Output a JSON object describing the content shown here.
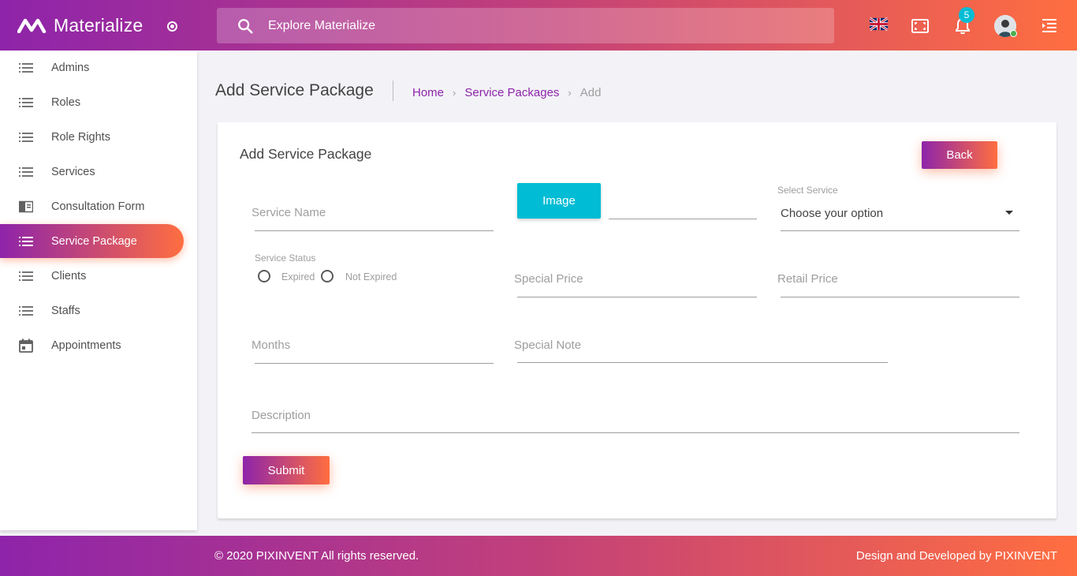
{
  "brand": {
    "name": "Materialize"
  },
  "header": {
    "search_placeholder": "Explore Materialize",
    "notification_count": "5"
  },
  "sidebar": {
    "items": [
      {
        "label": "Admins",
        "icon": "list-icon"
      },
      {
        "label": "Roles",
        "icon": "list-icon"
      },
      {
        "label": "Role Rights",
        "icon": "list-icon"
      },
      {
        "label": "Services",
        "icon": "list-icon"
      },
      {
        "label": "Consultation Form",
        "icon": "form-icon"
      },
      {
        "label": "Service Package",
        "icon": "list-icon",
        "active": true
      },
      {
        "label": "Clients",
        "icon": "list-icon"
      },
      {
        "label": "Staffs",
        "icon": "list-icon"
      },
      {
        "label": "Appointments",
        "icon": "calendar-icon"
      }
    ]
  },
  "page": {
    "title": "Add Service Package",
    "breadcrumbs": [
      "Home",
      "Service Packages",
      "Add"
    ]
  },
  "form": {
    "title": "Add Service Package",
    "back_label": "Back",
    "service_name_label": "Service Name",
    "image_button_label": "Image",
    "select_service_label": "Select Service",
    "select_service_value": "Choose your option",
    "service_status_label": "Service Status",
    "status_options": [
      "Expired",
      "Not Expired"
    ],
    "special_price_label": "Special Price",
    "retail_price_label": "Retail Price",
    "months_label": "Months",
    "special_note_label": "Special Note",
    "description_label": "Description",
    "submit_label": "Submit"
  },
  "footer": {
    "copyright": "© 2020 PIXINVENT All rights reserved.",
    "credit": "Design and Developed by PIXINVENT"
  },
  "colors": {
    "gradient_start": "#8e24aa",
    "gradient_end": "#ff6e40",
    "accent_cyan": "#00bcd4",
    "link_purple": "#8e24aa"
  }
}
